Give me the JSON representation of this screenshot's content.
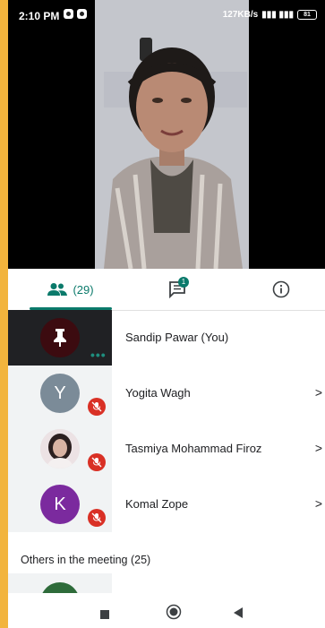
{
  "status_bar": {
    "time": "2:10 PM",
    "network_speed": "127KB/s",
    "battery": "81"
  },
  "tabs": {
    "people_count": "(29)",
    "chat_badge": "1"
  },
  "participants": [
    {
      "name": "Sandip Pawar (You)",
      "avatar_type": "pin-icon",
      "avatar_color": "#3c0b10",
      "muted": false,
      "you": true
    },
    {
      "name": "Yogita Wagh",
      "avatar_letter": "Y",
      "avatar_color": "#7b8b98",
      "muted": true
    },
    {
      "name": "Tasmiya Mohammad Firoz",
      "avatar_type": "photo",
      "muted": true
    },
    {
      "name": "Komal Zope",
      "avatar_letter": "K",
      "avatar_color": "#7b2a9e",
      "muted": true
    }
  ],
  "others_header": "Others in the meeting (25)",
  "colors": {
    "accent": "#0b7a6b",
    "mute_red": "#d93025"
  }
}
